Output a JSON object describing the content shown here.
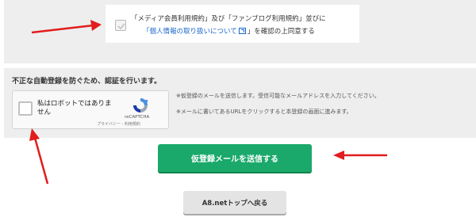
{
  "agreement": {
    "line1": "「メディア会員利用規約」及び「ファンブログ利用規約」並びに",
    "privacy_link": "「個人情報の取り扱いについて",
    "line2_suffix": "」を確認の上同意する",
    "checked": true
  },
  "captcha_section": {
    "title": "不正な自動登録を防ぐため、認証を行います。",
    "recaptcha": {
      "label": "私はロボットではありません",
      "brand": "reCAPTCHA",
      "terms": "プライバシー - 利用規約"
    },
    "note1": "※仮登録のメールを送信します。受信可能なメールアドレスを入力してください。",
    "note2": "※メールに書いてあるURLをクリックすると本登録の画面に進みます。"
  },
  "buttons": {
    "submit_label": "仮登録メールを送信する",
    "back_label": "A8.netトップへ戻る"
  },
  "colors": {
    "submit_bg": "#1aa96b",
    "link": "#1a66c9",
    "annotation_arrow": "#e11d1d"
  }
}
